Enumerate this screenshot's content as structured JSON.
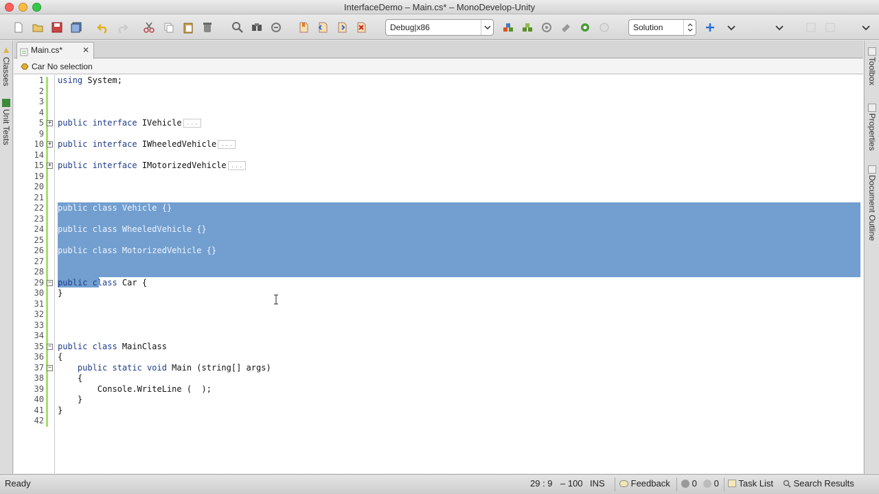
{
  "window": {
    "title": "InterfaceDemo – Main.cs* – MonoDevelop-Unity"
  },
  "toolbar": {
    "config_combo": "Debug|x86",
    "scope_combo": "Solution"
  },
  "left_pads": {
    "classes": "Classes",
    "unit_tests": "Unit Tests"
  },
  "right_pads": {
    "toolbox": "Toolbox",
    "properties": "Properties",
    "document_outline": "Document Outline"
  },
  "tab": {
    "label": "Main.cs*",
    "close": "✕"
  },
  "breadcrumb": {
    "class": "Car",
    "member": "No selection"
  },
  "editor": {
    "lines": [
      {
        "n": "1",
        "kw": "using",
        "rest": " System;"
      },
      {
        "n": "2",
        "kw": "",
        "rest": ""
      },
      {
        "n": "3",
        "kw": "",
        "rest": ""
      },
      {
        "n": "4",
        "kw": "",
        "rest": ""
      },
      {
        "n": "5",
        "kw": "public interface",
        "rest": " IVehicle"
      },
      {
        "n": "9",
        "kw": "",
        "rest": ""
      },
      {
        "n": "10",
        "kw": "public interface",
        "rest": " IWheeledVehicle"
      },
      {
        "n": "14",
        "kw": "",
        "rest": ""
      },
      {
        "n": "15",
        "kw": "public interface",
        "rest": " IMotorizedVehicle"
      },
      {
        "n": "19",
        "kw": "",
        "rest": ""
      },
      {
        "n": "20",
        "kw": "",
        "rest": ""
      },
      {
        "n": "21",
        "kw": "",
        "rest": ""
      },
      {
        "n": "22",
        "kw": "public class",
        "rest": " Vehicle {}"
      },
      {
        "n": "23",
        "kw": "",
        "rest": ""
      },
      {
        "n": "24",
        "kw": "public class",
        "rest": " WheeledVehicle {}"
      },
      {
        "n": "25",
        "kw": "",
        "rest": ""
      },
      {
        "n": "26",
        "kw": "public class",
        "rest": " MotorizedVehicle {}"
      },
      {
        "n": "27",
        "kw": "",
        "rest": ""
      },
      {
        "n": "28",
        "kw": "",
        "rest": ""
      },
      {
        "n": "29",
        "kw": "public class",
        "rest": " Car {"
      },
      {
        "n": "30",
        "kw": "",
        "rest": "}"
      },
      {
        "n": "31",
        "kw": "",
        "rest": ""
      },
      {
        "n": "32",
        "kw": "",
        "rest": ""
      },
      {
        "n": "33",
        "kw": "",
        "rest": ""
      },
      {
        "n": "34",
        "kw": "",
        "rest": ""
      },
      {
        "n": "35",
        "kw": "public class",
        "rest": " MainClass"
      },
      {
        "n": "36",
        "kw": "",
        "rest": "{"
      },
      {
        "n": "37",
        "kw": "    public static void",
        "rest": " Main (string[] args)"
      },
      {
        "n": "38",
        "kw": "",
        "rest": "    {"
      },
      {
        "n": "39",
        "kw": "",
        "rest": "        Console.WriteLine (  );"
      },
      {
        "n": "40",
        "kw": "",
        "rest": "    }"
      },
      {
        "n": "41",
        "kw": "",
        "rest": "}"
      },
      {
        "n": "42",
        "kw": "",
        "rest": ""
      }
    ],
    "folded_marker": "...",
    "fold_plus": "+",
    "fold_minus": "−"
  },
  "status": {
    "ready": "Ready",
    "position": "29 : 9",
    "zoom": "– 100",
    "mode": "INS",
    "feedback": "Feedback",
    "errors": "0",
    "warnings": "0",
    "task_list": "Task List",
    "search_results": "Search Results"
  },
  "colors": {
    "selection": "#729fcf",
    "keyword": "#1f3c8a",
    "change_bar": "#a6e06a"
  }
}
